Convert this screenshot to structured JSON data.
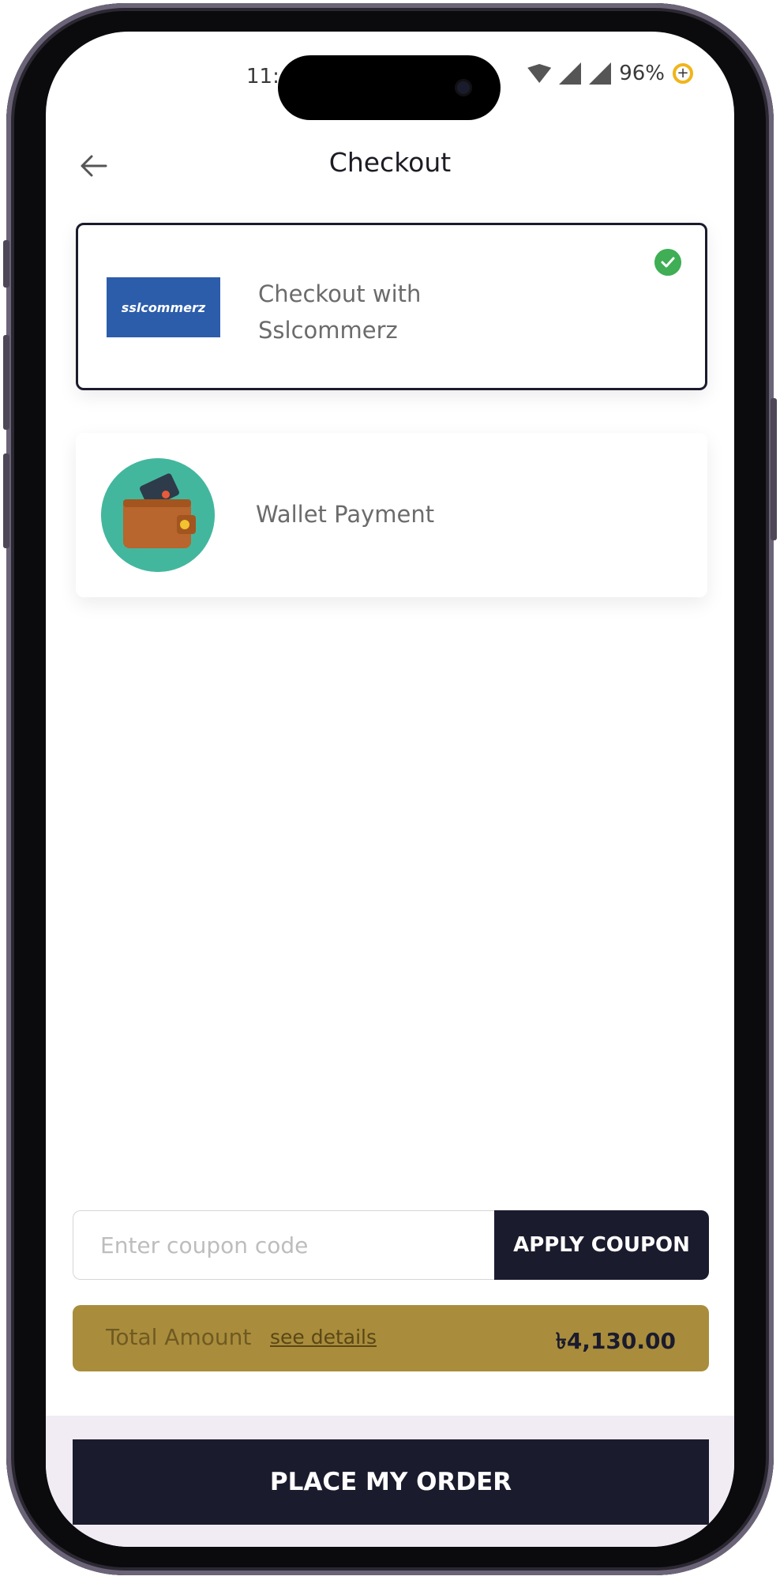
{
  "status_bar": {
    "time": "11:",
    "battery": "96%",
    "battery_icon_glyph": "+"
  },
  "header": {
    "title": "Checkout",
    "back_icon": "arrow-left-icon"
  },
  "payment_methods": [
    {
      "label_line1": "Checkout with",
      "label_line2": "Sslcommerz",
      "logo_text": "sslcommerz",
      "selected": true
    },
    {
      "label": "Wallet Payment",
      "selected": false
    }
  ],
  "coupon": {
    "placeholder": "Enter coupon code",
    "value": "",
    "apply_label": "APPLY COUPON"
  },
  "total": {
    "label": "Total Amount",
    "details_link": "see details",
    "amount": "৳4,130.00"
  },
  "place_order_label": "PLACE MY ORDER",
  "colors": {
    "primary_dark": "#1b1b2e",
    "gold": "#a98d3c",
    "success": "#3fae55",
    "wallet_bg": "#43b79e"
  }
}
